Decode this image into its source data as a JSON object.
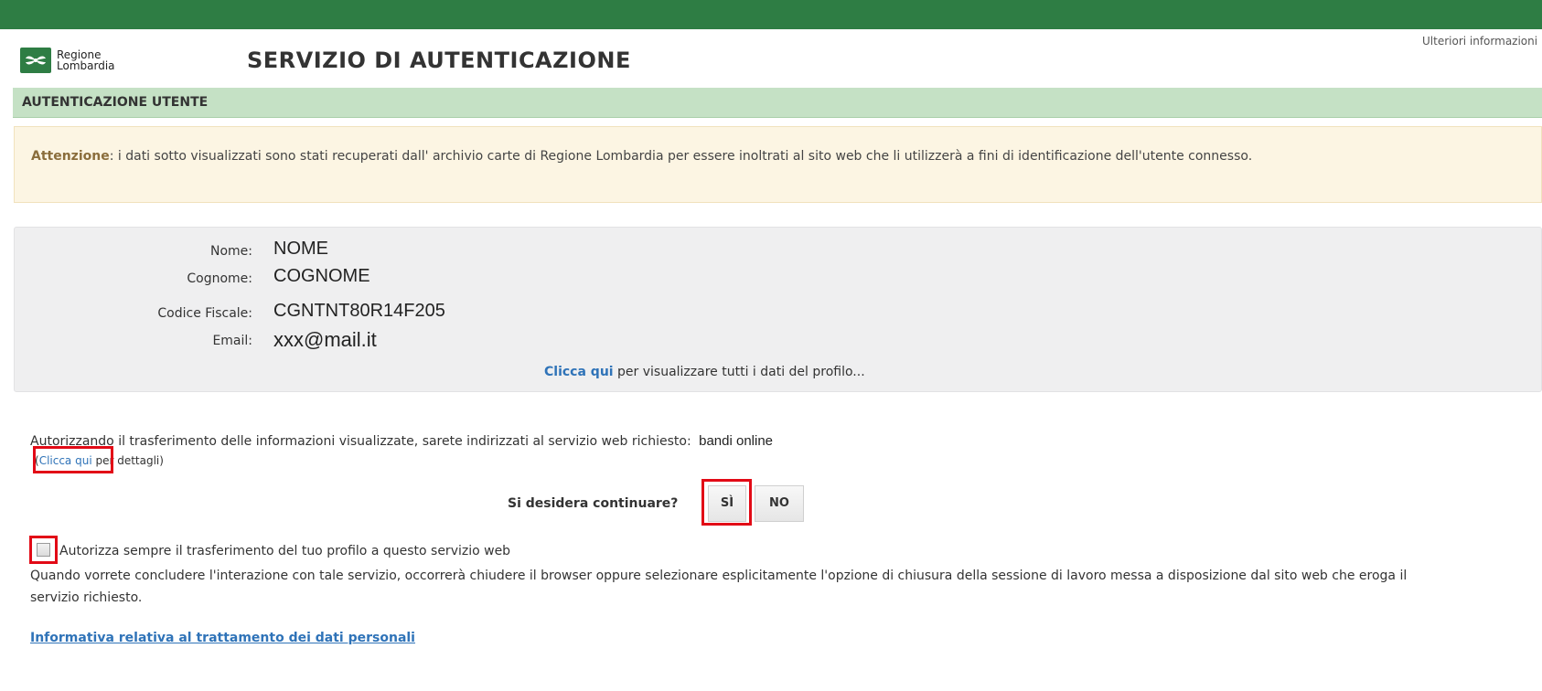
{
  "header": {
    "logo_line1": "Regione",
    "logo_line2": "Lombardia",
    "title": "SERVIZIO DI AUTENTICAZIONE",
    "more_info": "Ulteriori informazioni"
  },
  "section": {
    "title": "AUTENTICAZIONE UTENTE"
  },
  "warning": {
    "label": "Attenzione",
    "text": ": i dati sotto visualizzati sono stati recuperati dall' archivio carte di Regione Lombardia per essere inoltrati al sito web che li utilizzerà a fini di identificazione dell'utente connesso."
  },
  "profile": {
    "fields": [
      {
        "label": "Nome:",
        "value": "NOME"
      },
      {
        "label": "Cognome:",
        "value": "COGNOME"
      },
      {
        "label": "Codice Fiscale:",
        "value": "CGNTNT80R14F205"
      },
      {
        "label": "Email:",
        "value": "xxx@mail.it"
      }
    ],
    "link_label": "Clicca qui",
    "link_suffix": " per visualizzare tutti i dati del profilo..."
  },
  "authorization": {
    "text": "Autorizzando il trasferimento delle informazioni visualizzate, sarete indirizzati al servizio web richiesto:",
    "service": "bandi online",
    "details_open": "(",
    "details_link": "Clicca qui",
    "details_suffix": " per dettagli)"
  },
  "confirm": {
    "question": "Si desidera continuare?",
    "yes_label": "SÌ",
    "no_label": "NO"
  },
  "always": {
    "checkbox_label": "Autorizza sempre il trasferimento del tuo profilo a questo servizio web",
    "checked": false
  },
  "close_note": "Quando vorrete concludere l'interazione con tale servizio, occorrerà chiudere il browser oppure selezionare esplicitamente l'opzione di chiusura della sessione di lavoro messa a disposizione dal sito web che eroga il servizio richiesto.",
  "privacy_link": "Informativa relativa al trattamento dei dati personali",
  "colors": {
    "topbar": "#2e7d44",
    "section_bg": "#c5e1c5",
    "warning_bg": "#fcf5e3",
    "link": "#2f73b8",
    "highlight": "#e20a16"
  }
}
